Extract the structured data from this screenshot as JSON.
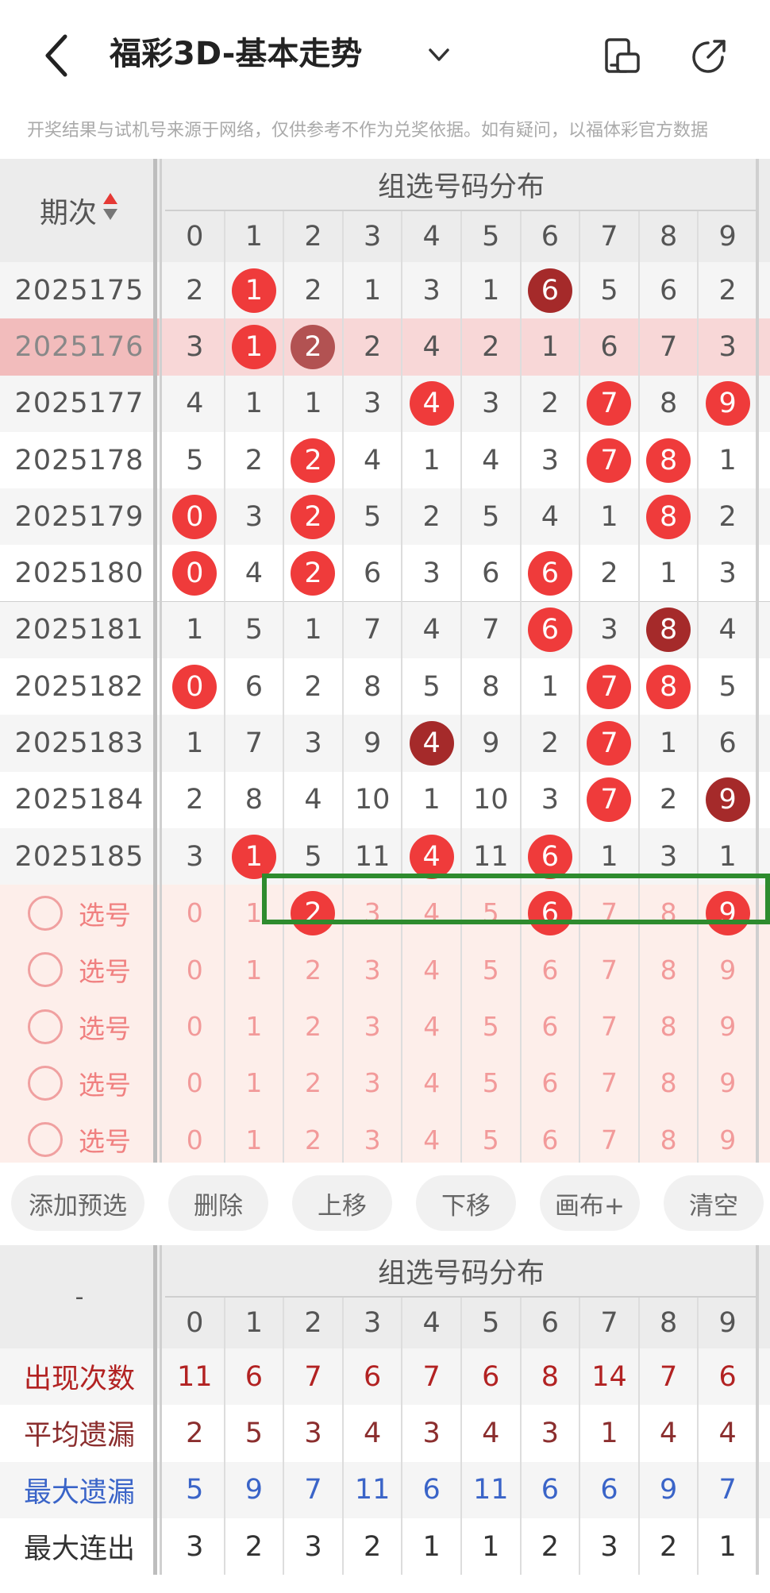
{
  "header": {
    "title": "福彩3D-基本走势",
    "notice": "开奖结果与试机号来源于网络，仅供参考不作为兑奖依据。如有疑问，以福体彩官方数据"
  },
  "top_table": {
    "period_header": "期次",
    "group_header": "组选号码分布",
    "digits": [
      "0",
      "1",
      "2",
      "3",
      "4",
      "5",
      "6",
      "7",
      "8",
      "9"
    ],
    "rows": [
      {
        "period": "2025175",
        "cells": [
          "2",
          "1",
          "2",
          "1",
          "3",
          "1",
          "6",
          "5",
          "6",
          "2"
        ],
        "balls": {
          "1": "red",
          "6": "dark"
        }
      },
      {
        "period": "2025176",
        "cells": [
          "3",
          "1",
          "2",
          "2",
          "4",
          "2",
          "1",
          "6",
          "7",
          "3"
        ],
        "balls": {
          "1": "red",
          "2": "grey"
        },
        "highlight": true
      },
      {
        "period": "2025177",
        "cells": [
          "4",
          "1",
          "1",
          "3",
          "4",
          "3",
          "2",
          "7",
          "8",
          "9"
        ],
        "balls": {
          "4": "red",
          "7": "red",
          "9": "red"
        }
      },
      {
        "period": "2025178",
        "cells": [
          "5",
          "2",
          "2",
          "4",
          "1",
          "4",
          "3",
          "7",
          "8",
          "1"
        ],
        "balls": {
          "2": "red",
          "7": "red",
          "8": "red"
        }
      },
      {
        "period": "2025179",
        "cells": [
          "0",
          "3",
          "2",
          "5",
          "2",
          "5",
          "4",
          "1",
          "8",
          "2"
        ],
        "balls": {
          "0": "red",
          "2": "red",
          "8": "red"
        }
      },
      {
        "period": "2025180",
        "cells": [
          "0",
          "4",
          "2",
          "6",
          "3",
          "6",
          "6",
          "2",
          "1",
          "3"
        ],
        "balls": {
          "0": "red",
          "2": "red",
          "6": "red"
        }
      },
      {
        "period": "2025181",
        "cells": [
          "1",
          "5",
          "1",
          "7",
          "4",
          "7",
          "6",
          "3",
          "8",
          "4"
        ],
        "balls": {
          "6": "red",
          "8": "dark"
        }
      },
      {
        "period": "2025182",
        "cells": [
          "0",
          "6",
          "2",
          "8",
          "5",
          "8",
          "1",
          "7",
          "8",
          "5"
        ],
        "balls": {
          "0": "red",
          "7": "red",
          "8": "red"
        }
      },
      {
        "period": "2025183",
        "cells": [
          "1",
          "7",
          "3",
          "9",
          "4",
          "9",
          "2",
          "7",
          "1",
          "6"
        ],
        "balls": {
          "4": "dark",
          "7": "red"
        }
      },
      {
        "period": "2025184",
        "cells": [
          "2",
          "8",
          "4",
          "10",
          "1",
          "10",
          "3",
          "7",
          "2",
          "9"
        ],
        "balls": {
          "7": "red",
          "9": "dark"
        }
      },
      {
        "period": "2025185",
        "cells": [
          "3",
          "1",
          "5",
          "11",
          "4",
          "11",
          "6",
          "1",
          "3",
          "1"
        ],
        "balls": {
          "1": "red",
          "4": "red",
          "6": "red"
        }
      }
    ],
    "pick_label": "选号",
    "pick_rows": [
      {
        "cells": [
          "0",
          "1",
          "2",
          "3",
          "4",
          "5",
          "6",
          "7",
          "8",
          "9"
        ],
        "balls": {
          "2": "red",
          "6": "red",
          "9": "red"
        }
      },
      {
        "cells": [
          "0",
          "1",
          "2",
          "3",
          "4",
          "5",
          "6",
          "7",
          "8",
          "9"
        ],
        "balls": {}
      },
      {
        "cells": [
          "0",
          "1",
          "2",
          "3",
          "4",
          "5",
          "6",
          "7",
          "8",
          "9"
        ],
        "balls": {}
      },
      {
        "cells": [
          "0",
          "1",
          "2",
          "3",
          "4",
          "5",
          "6",
          "7",
          "8",
          "9"
        ],
        "balls": {}
      },
      {
        "cells": [
          "0",
          "1",
          "2",
          "3",
          "4",
          "5",
          "6",
          "7",
          "8",
          "9"
        ],
        "balls": {}
      }
    ]
  },
  "buttons": [
    "添加预选",
    "删除",
    "上移",
    "下移",
    "画布+",
    "清空"
  ],
  "stats_table": {
    "corner": "-",
    "group_header": "组选号码分布",
    "digits": [
      "0",
      "1",
      "2",
      "3",
      "4",
      "5",
      "6",
      "7",
      "8",
      "9"
    ],
    "rows": [
      {
        "label": "出现次数",
        "color": "#b22222",
        "values": [
          "11",
          "6",
          "7",
          "6",
          "7",
          "6",
          "8",
          "14",
          "7",
          "6"
        ]
      },
      {
        "label": "平均遗漏",
        "color": "#8b2e2e",
        "values": [
          "2",
          "5",
          "3",
          "4",
          "3",
          "4",
          "3",
          "1",
          "4",
          "4"
        ]
      },
      {
        "label": "最大遗漏",
        "color": "#3a64c8",
        "values": [
          "5",
          "9",
          "7",
          "11",
          "6",
          "11",
          "6",
          "6",
          "9",
          "7"
        ]
      },
      {
        "label": "最大连出",
        "color": "#333333",
        "values": [
          "3",
          "2",
          "3",
          "2",
          "1",
          "1",
          "2",
          "3",
          "2",
          "1"
        ]
      }
    ]
  },
  "colors": {
    "red_ball": "#ef3b3b",
    "dark_ball": "#a52a2a",
    "pick_bg": "#fdeeea",
    "highlight_row": "#f8d7d7",
    "header_bg": "#ececec",
    "green_box": "#2e8b2e"
  }
}
